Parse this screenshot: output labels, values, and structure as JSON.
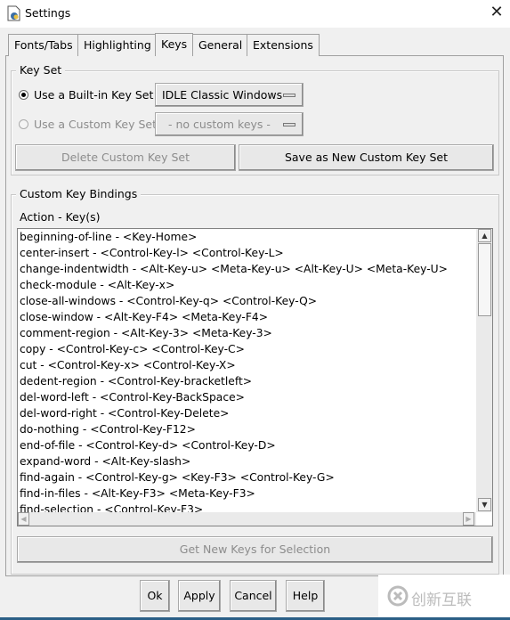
{
  "window": {
    "title": "Settings",
    "close": "✕"
  },
  "tabs": [
    {
      "label": "Fonts/Tabs"
    },
    {
      "label": "Highlighting"
    },
    {
      "label": "Keys",
      "selected": true
    },
    {
      "label": "General"
    },
    {
      "label": "Extensions"
    }
  ],
  "keyset": {
    "group_label": "Key Set",
    "builtin_label": "Use a Built-in Key Set",
    "builtin_selected": true,
    "builtin_value": "IDLE Classic Windows",
    "custom_label": "Use a Custom Key Set",
    "custom_value": "- no custom keys -",
    "delete_label": "Delete Custom Key Set",
    "save_label": "Save as New Custom Key Set"
  },
  "bindings": {
    "group_label": "Custom Key Bindings",
    "header": "Action - Key(s)",
    "items": [
      "beginning-of-line - <Key-Home>",
      "center-insert - <Control-Key-l> <Control-Key-L>",
      "change-indentwidth - <Alt-Key-u> <Meta-Key-u> <Alt-Key-U> <Meta-Key-U>",
      "check-module - <Alt-Key-x>",
      "close-all-windows - <Control-Key-q> <Control-Key-Q>",
      "close-window - <Alt-Key-F4> <Meta-Key-F4>",
      "comment-region - <Alt-Key-3> <Meta-Key-3>",
      "copy - <Control-Key-c> <Control-Key-C>",
      "cut - <Control-Key-x> <Control-Key-X>",
      "dedent-region - <Control-Key-bracketleft>",
      "del-word-left - <Control-Key-BackSpace>",
      "del-word-right - <Control-Key-Delete>",
      "do-nothing - <Control-Key-F12>",
      "end-of-file - <Control-Key-d> <Control-Key-D>",
      "expand-word - <Alt-Key-slash>",
      "find-again - <Control-Key-g> <Key-F3> <Control-Key-G>",
      "find-in-files - <Alt-Key-F3> <Meta-Key-F3>",
      "find-selection - <Control-Key-F3>"
    ],
    "get_new_keys_label": "Get New Keys for Selection"
  },
  "footer": {
    "ok": "Ok",
    "apply": "Apply",
    "cancel": "Cancel",
    "help": "Help"
  },
  "watermark": "创新互联"
}
